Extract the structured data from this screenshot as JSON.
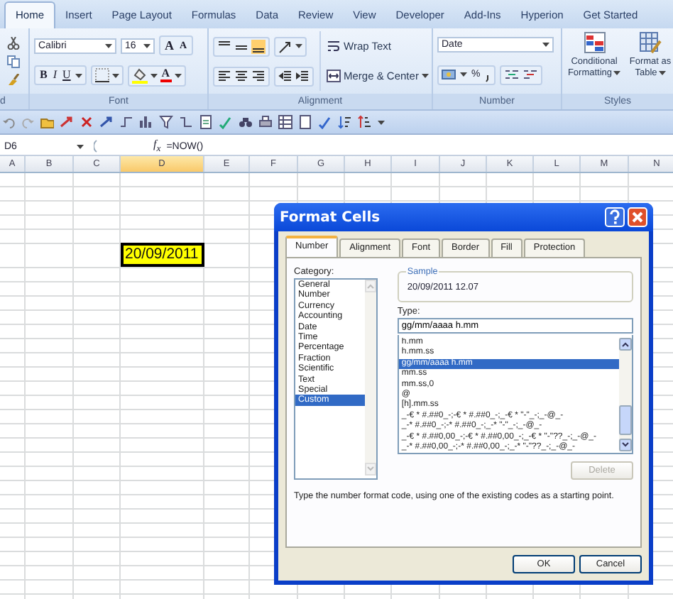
{
  "ribbon": {
    "tabs": [
      {
        "label": "Home",
        "selected": true
      },
      {
        "label": "Insert",
        "selected": false
      },
      {
        "label": "Page Layout",
        "selected": false
      },
      {
        "label": "Formulas",
        "selected": false
      },
      {
        "label": "Data",
        "selected": false
      },
      {
        "label": "Review",
        "selected": false
      },
      {
        "label": "View",
        "selected": false
      },
      {
        "label": "Developer",
        "selected": false
      },
      {
        "label": "Add-Ins",
        "selected": false
      },
      {
        "label": "Hyperion",
        "selected": false
      },
      {
        "label": "Get Started",
        "selected": false
      }
    ],
    "clipboard": {
      "label": "d"
    },
    "font": {
      "label": "Font",
      "name": "Calibri",
      "size": "16",
      "grow": "A",
      "shrink": "A",
      "bold": "B",
      "italic": "I",
      "underline": "U",
      "font_color_label": "A"
    },
    "alignment": {
      "label": "Alignment",
      "wrap_text": "Wrap Text",
      "merge": "Merge & Center"
    },
    "number": {
      "label": "Number",
      "format": "Date",
      "percent": "%"
    },
    "styles": {
      "label": "Styles",
      "buttons": [
        "Conditional Formatting",
        "Format as Table"
      ]
    }
  },
  "formula_bar": {
    "name_box": "D6",
    "fx": "f$_{x}$",
    "formula": "=NOW()"
  },
  "sheet": {
    "columns": [
      {
        "label": "A",
        "selected": false
      },
      {
        "label": "B",
        "selected": false
      },
      {
        "label": "C",
        "selected": false
      },
      {
        "label": "D",
        "selected": true
      },
      {
        "label": "E",
        "selected": false
      },
      {
        "label": "F",
        "selected": false
      },
      {
        "label": "G",
        "selected": false
      },
      {
        "label": "H",
        "selected": false
      },
      {
        "label": "I",
        "selected": false
      },
      {
        "label": "J",
        "selected": false
      },
      {
        "label": "K",
        "selected": false
      },
      {
        "label": "L",
        "selected": false
      },
      {
        "label": "M",
        "selected": false
      },
      {
        "label": "N",
        "selected": false
      }
    ],
    "active_cell": "20/09/2011"
  },
  "dialog": {
    "title": "Format Cells",
    "tabs": [
      {
        "label": "Number",
        "selected": true
      },
      {
        "label": "Alignment",
        "selected": false
      },
      {
        "label": "Font",
        "selected": false
      },
      {
        "label": "Border",
        "selected": false
      },
      {
        "label": "Fill",
        "selected": false
      },
      {
        "label": "Protection",
        "selected": false
      }
    ],
    "category_label": "Category:",
    "categories": [
      {
        "label": "General",
        "selected": false
      },
      {
        "label": "Number",
        "selected": false
      },
      {
        "label": "Currency",
        "selected": false
      },
      {
        "label": "Accounting",
        "selected": false
      },
      {
        "label": "Date",
        "selected": false
      },
      {
        "label": "Time",
        "selected": false
      },
      {
        "label": "Percentage",
        "selected": false
      },
      {
        "label": "Fraction",
        "selected": false
      },
      {
        "label": "Scientific",
        "selected": false
      },
      {
        "label": "Text",
        "selected": false
      },
      {
        "label": "Special",
        "selected": false
      },
      {
        "label": "Custom",
        "selected": true
      }
    ],
    "sample_label": "Sample",
    "sample": "20/09/2011 12.07",
    "type_label": "Type:",
    "type_value": "gg/mm/aaaa h.mm",
    "types": [
      {
        "label": "h.mm",
        "selected": false
      },
      {
        "label": "h.mm.ss",
        "selected": false
      },
      {
        "label": "gg/mm/aaaa h.mm",
        "selected": true
      },
      {
        "label": "mm.ss",
        "selected": false
      },
      {
        "label": "mm.ss,0",
        "selected": false
      },
      {
        "label": "@",
        "selected": false
      },
      {
        "label": "[h].mm.ss",
        "selected": false
      },
      {
        "label": "_-€ * #.##0_-;-€ * #.##0_-;_-€ * \"-\"_-;_-@_-",
        "selected": false
      },
      {
        "label": "_-* #.##0_-;-* #.##0_-;_-* \"-\"_-;_-@_-",
        "selected": false
      },
      {
        "label": "_-€ * #.##0,00_-;-€ * #.##0,00_-;_-€ * \"-\"??_-;_-@_-",
        "selected": false
      },
      {
        "label": "_-* #.##0,00_-;-* #.##0,00_-;_-* \"-\"??_-;_-@_-",
        "selected": false
      }
    ],
    "delete": {
      "label": "Delete",
      "disabled": true
    },
    "hint": "Type the number format code, using one of the existing codes as a starting point.",
    "buttons": [
      "OK",
      "Cancel"
    ]
  }
}
